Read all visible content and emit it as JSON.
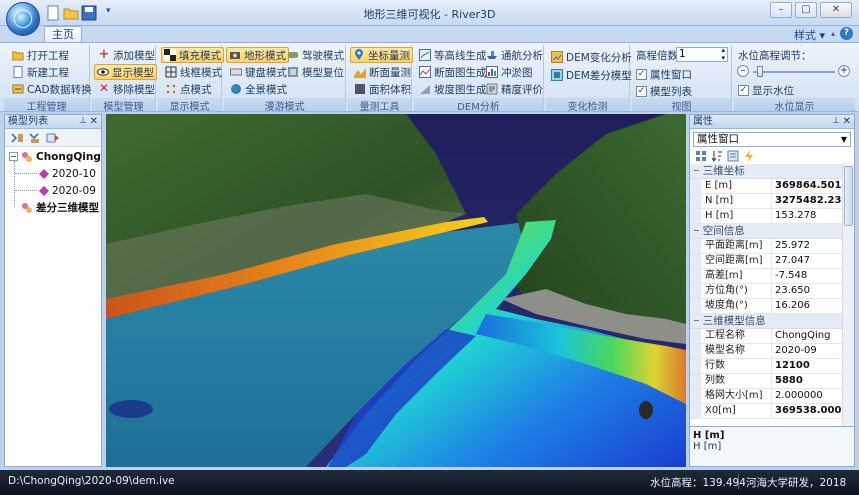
{
  "window": {
    "title": "地形三维可视化 - River3D",
    "buttons": {
      "minimize": "–",
      "restore": "□",
      "close": "✕"
    }
  },
  "tabs": {
    "home": "主页"
  },
  "top_right": {
    "style_menu": "样式",
    "help": "?"
  },
  "ribbon": {
    "project": {
      "label": "工程管理",
      "open": "打开工程",
      "new": "新建工程",
      "cad": "CAD数据转换"
    },
    "model": {
      "label": "模型管理",
      "add": "添加模型",
      "show": "显示模型",
      "remove": "移除模型"
    },
    "display": {
      "label": "显示模式",
      "fill": "填充模式",
      "wire": "线框模式",
      "point": "点模式"
    },
    "roam": {
      "label": "漫游模式",
      "terrain": "地形模式",
      "fly": "驾驶模式",
      "keyboard": "键盘模式",
      "reset": "模型复位",
      "panorama": "全景模式"
    },
    "measure": {
      "label": "量测工具",
      "coord": "坐标量测",
      "section": "断面量测",
      "area": "面积体积"
    },
    "dem": {
      "label": "DEM分析",
      "contour": "等高线生成",
      "navigation": "通航分析",
      "section_gen": "断面图生成",
      "erosion": "冲淤图",
      "slope": "坡度图生成",
      "accuracy": "精度评价"
    },
    "change": {
      "label": "变化检测",
      "dem_change": "DEM变化分析",
      "dem_diff": "DEM差分模型"
    },
    "view": {
      "label": "视图",
      "elev_factor_label": "高程倍数",
      "elev_factor_value": "1",
      "prop_window": "属性窗口",
      "model_list": "模型列表"
    },
    "water": {
      "label": "水位显示",
      "adjust_label": "水位高程调节：",
      "show_water": "显示水位"
    }
  },
  "model_list": {
    "title": "模型列表",
    "tree": [
      {
        "label": "ChongQing",
        "level": 0,
        "bold": true
      },
      {
        "label": "2020-10",
        "level": 1,
        "bold": false
      },
      {
        "label": "2020-09",
        "level": 1,
        "bold": false
      },
      {
        "label": "差分三维模型",
        "level": 0,
        "bold": true
      }
    ]
  },
  "properties": {
    "title": "属性",
    "selector": "属性窗口",
    "categories": [
      {
        "name": "三维坐标",
        "rows": [
          {
            "key": "E [m]",
            "value": "369864.501",
            "bold": true
          },
          {
            "key": "N [m]",
            "value": "3275482.237",
            "bold": true
          },
          {
            "key": "H [m]",
            "value": "153.278",
            "bold": false
          }
        ]
      },
      {
        "name": "空间信息",
        "rows": [
          {
            "key": "平面距离[m]",
            "value": "25.972",
            "bold": false
          },
          {
            "key": "空间距离[m]",
            "value": "27.047",
            "bold": false
          },
          {
            "key": "高差[m]",
            "value": "-7.548",
            "bold": false
          },
          {
            "key": "方位角(°)",
            "value": "23.650",
            "bold": false
          },
          {
            "key": "坡度角(°)",
            "value": "16.206",
            "bold": false
          }
        ]
      },
      {
        "name": "三维模型信息",
        "rows": [
          {
            "key": "工程名称",
            "value": "ChongQing",
            "bold": false
          },
          {
            "key": "模型名称",
            "value": "2020-09",
            "bold": false
          },
          {
            "key": "行数",
            "value": "12100",
            "bold": true
          },
          {
            "key": "列数",
            "value": "5880",
            "bold": true
          },
          {
            "key": "格网大小[m]",
            "value": "2.000000",
            "bold": false
          },
          {
            "key": "X0[m]",
            "value": "369538.000",
            "bold": true
          }
        ]
      }
    ],
    "description": {
      "title": "H [m]",
      "text": "H [m]"
    }
  },
  "status": {
    "path": "D:\\ChongQing\\2020-09\\dem.ive",
    "water_level": "水位高程：139.494",
    "org": "河海大学研发，2018"
  }
}
